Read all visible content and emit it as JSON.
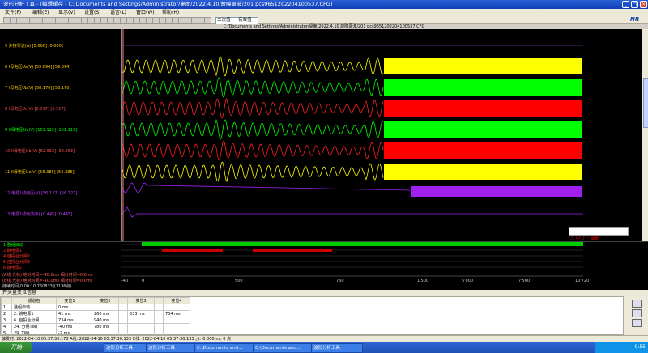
{
  "window": {
    "title": "波形分析工具 - [编辑缓存 - C:/Documents and Settings/Administrator/桌面/2022.4.10 故障录波/201 pcs9651202204100537.CFG]"
  },
  "menu": [
    "文件(F)",
    "编辑(E)",
    "显示(V)",
    "设置(S)",
    "语言(L)",
    "窗口(W)",
    "帮助(H)"
  ],
  "toolbar": {
    "select1": "二次值",
    "select2": "有效值",
    "brand": "NR"
  },
  "path": "C:/Documents and Settings/Administrator/桌面/2022.4.10 故障录波/201 pcs9651202204100537.CFG",
  "channels": [
    {
      "label": "5 外接零流(A)   [0.000] [0.000]",
      "color": "#ffd000",
      "wave": "#7030a0",
      "type": "flat"
    },
    {
      "label": "6 I母电压Ua(V)   [59.694] [59.694]",
      "color": "#ffd000",
      "wave": "#ffff00",
      "type": "osc",
      "bar": "#ffff00"
    },
    {
      "label": "7 I母电压Ub(V)   [58.170] [58.170]",
      "color": "#ffd000",
      "wave": "#00ff00",
      "type": "osc",
      "bar": "#00ff00"
    },
    {
      "label": "8 I母电压Uc(V)   [0.517] [0.517]",
      "color": "#ff5050",
      "wave": "#ff2020",
      "type": "osc",
      "bar": "#ff0000"
    },
    {
      "label": "9 II母电压Ua(V)   [101.113] [101.113]",
      "color": "#00ff00",
      "wave": "#00ff00",
      "type": "osc",
      "bar": "#00ff00"
    },
    {
      "label": "10 II母电压Ub(V)   [62.963] [62.963]",
      "color": "#ff5050",
      "wave": "#ff2020",
      "type": "osc",
      "bar": "#ff0000"
    },
    {
      "label": "11 II母电压Uc(V)   [56.386] [56.386]",
      "color": "#ffd000",
      "wave": "#ffff00",
      "type": "osc",
      "bar": "#ffff00"
    },
    {
      "label": "12 电源1线电压(V)   [56.127] [56.127]",
      "color": "#c040ff",
      "wave": "#a020f0",
      "type": "flat2",
      "bar": "#a020f0"
    },
    {
      "label": "13 电源1线电流(A)   [0.445] [0.445]",
      "color": "#c040ff",
      "wave": "#a020f0",
      "type": "small"
    }
  ],
  "switches": [
    {
      "label": "1 整组启动",
      "color": "#00ff00"
    },
    {
      "label": "2 跳电源1",
      "color": "#ff3030"
    },
    {
      "label": "4 自投合分闸2",
      "color": "#ff3030"
    },
    {
      "label": "5 自投合分闸3",
      "color": "#ff3030"
    },
    {
      "label": "6 跳电源2",
      "color": "#ff3030"
    }
  ],
  "info": [
    "(A线 光标) 绝对时间=-40.0ms 相对时间=0.0ms",
    "(B线 光标) 绝对时间=-40.0ms 相对时间=0.0ms",
    "持续时间[0.00:10.760833](1136点)"
  ],
  "axis_ticks": [
    "-40",
    "0",
    "500",
    "750",
    "1'500",
    "5'000",
    "7'500",
    "10'720"
  ],
  "bottom_title": "开关量变位信息",
  "table": {
    "headers": [
      "",
      "通道名",
      "变位1",
      "",
      "变位2",
      "",
      "变位3",
      "",
      "变位4"
    ],
    "rows": [
      [
        "1",
        "整组启动",
        "0 ms",
        "",
        "",
        "",
        "",
        "",
        ""
      ],
      [
        "2",
        "2. 跳电源1",
        "41 ms",
        "",
        "260 ms",
        "",
        "533 ms",
        "",
        "734 ms"
      ],
      [
        "3",
        "6. 自投合分闸",
        "734 ms",
        "",
        "940 ms",
        "",
        "",
        "",
        ""
      ],
      [
        "4",
        "24. 分闸TWJ",
        "-40 ms",
        "",
        "780 ms",
        "",
        "",
        "",
        ""
      ],
      [
        "5",
        "29. TWJ",
        "-2 ms",
        "",
        "",
        "",
        "",
        "",
        ""
      ]
    ]
  },
  "status": "触发时: 2022-04-10 05:37:30.173 A线: 2022-04-10 05:37:30.133 C线: 2022-04-10 05:37:30.133 △t: 0.000ms, 0 点",
  "taskbar": {
    "start": "开始",
    "tasks": [
      "波形分析工具",
      "波形分析工具",
      "C:\\Documents and...",
      "C:\\Documents and...",
      "波形分析工具"
    ],
    "time": "9:55"
  }
}
